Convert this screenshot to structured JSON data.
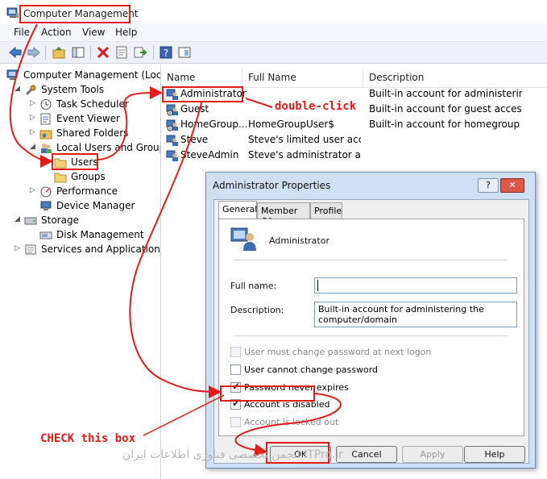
{
  "window": {
    "title": "Computer Management"
  },
  "menu": [
    "File",
    "Action",
    "View",
    "Help"
  ],
  "toolbar": [
    "back-icon",
    "forward-icon",
    "up-folder-icon",
    "console-tree-icon",
    "delete-icon",
    "properties-icon",
    "export-icon",
    "help-icon",
    "extended-view-icon"
  ],
  "tree": {
    "items": [
      {
        "label": "Computer Management (Local",
        "icon": "computer-management-icon",
        "arrow": ""
      },
      {
        "label": "System Tools",
        "icon": "tools-icon",
        "arrow": "◢"
      },
      {
        "label": "Task Scheduler",
        "icon": "clock-icon",
        "arrow": "▷"
      },
      {
        "label": "Event Viewer",
        "icon": "event-viewer-icon",
        "arrow": "▷"
      },
      {
        "label": "Shared Folders",
        "icon": "shared-folder-icon",
        "arrow": "▷"
      },
      {
        "label": "Local Users and Groups",
        "icon": "users-group-icon",
        "arrow": "◢"
      },
      {
        "label": "Users",
        "icon": "folder-icon",
        "arrow": ""
      },
      {
        "label": "Groups",
        "icon": "folder-icon",
        "arrow": ""
      },
      {
        "label": "Performance",
        "icon": "performance-icon",
        "arrow": "▷"
      },
      {
        "label": "Device Manager",
        "icon": "device-manager-icon",
        "arrow": ""
      },
      {
        "label": "Storage",
        "icon": "storage-icon",
        "arrow": "◢"
      },
      {
        "label": "Disk Management",
        "icon": "disk-icon",
        "arrow": ""
      },
      {
        "label": "Services and Applications",
        "icon": "services-icon",
        "arrow": "▷"
      }
    ]
  },
  "list": {
    "headers": [
      "Name",
      "Full Name",
      "Description"
    ],
    "rows": [
      {
        "name": "Administrator",
        "full": "",
        "desc": "Built-in account for administering..."
      },
      {
        "name": "Guest",
        "full": "",
        "desc": "Built-in account for guest access t..."
      },
      {
        "name": "HomeGroup...",
        "full": "HomeGroupUser$",
        "desc": "Built-in account for homegroup a..."
      },
      {
        "name": "Steve",
        "full": "Steve's limited user acco...",
        "desc": ""
      },
      {
        "name": "SteveAdmin",
        "full": "Steve's administrator ac...",
        "desc": ""
      }
    ]
  },
  "dialog": {
    "title": "Administrator Properties",
    "help_btn": "?",
    "close_btn": "✕",
    "tabs": [
      "General",
      "Member Of",
      "Profile"
    ],
    "username": "Administrator",
    "fullname_label": "Full name:",
    "fullname_value": "",
    "description_label": "Description:",
    "description_value": "Built-in account for administering the computer/domain",
    "checkboxes": [
      {
        "label": "User must change password at next logon",
        "checked": false,
        "disabled": true
      },
      {
        "label": "User cannot change password",
        "checked": false,
        "disabled": false
      },
      {
        "label": "Password never expires",
        "checked": true,
        "disabled": false
      },
      {
        "label": "Account is disabled",
        "checked": true,
        "disabled": false
      },
      {
        "label": "Account is locked out",
        "checked": false,
        "disabled": true
      }
    ],
    "buttons": [
      "OK",
      "Cancel",
      "Apply",
      "Help"
    ]
  },
  "annotations": {
    "double_click": "double-click",
    "check_box": "CHECK this box"
  },
  "watermark": "انجمن تخصصی فناوری اطلاعات ایران ITPro.ir",
  "colors": {
    "annotation": "#e41b1b",
    "dialog_frame": "#cfe0f4"
  }
}
